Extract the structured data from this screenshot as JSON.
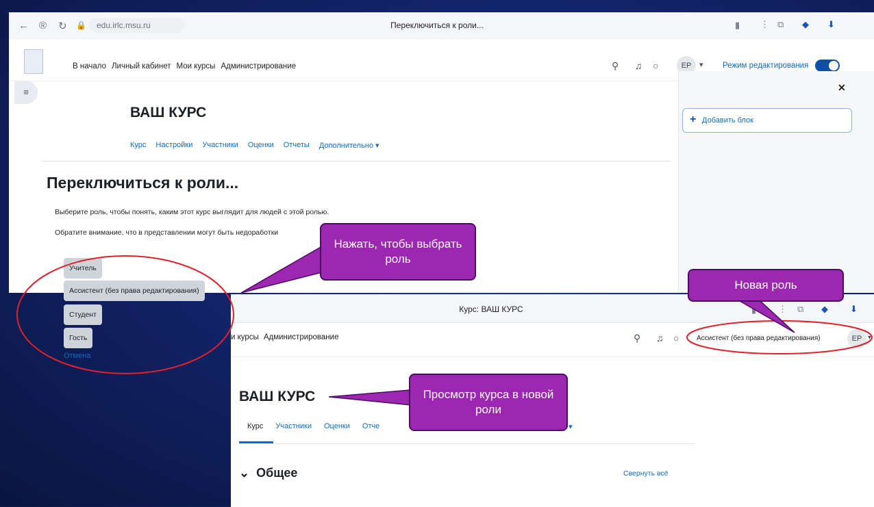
{
  "browser1": {
    "url": "edu.irlc.msu.ru",
    "tab_title": "Переключиться к роли..."
  },
  "nav": {
    "links": [
      "В начало",
      "Личный кабинет",
      "Мои курсы",
      "Администрирование"
    ],
    "avatar_initials": "ЕР",
    "edit_mode_label": "Режим редактирования",
    "edit_mode_on": true
  },
  "right_panel": {
    "add_block_label": "Добавить блок"
  },
  "course": {
    "title": "ВАШ КУРС",
    "tabs": [
      "Курс",
      "Настройки",
      "Участники",
      "Оценки",
      "Отчеты",
      "Дополнительно ▾"
    ]
  },
  "switch_role": {
    "heading": "Переключиться к роли...",
    "desc1": "Выберите роль, чтобы понять, каким этот курс выглядит для людей с этой ролью.",
    "desc2": "Обратите внимание, что в представлении могут быть недоработки",
    "roles": [
      "Учитель",
      "Ассистент (без права редактирования)",
      "Студент",
      "Гость"
    ],
    "cancel_label": "Отмена"
  },
  "browser2": {
    "tab_title": "Курс: ВАШ КУРС",
    "nav_links": [
      "и курсы",
      "Администрирование"
    ],
    "current_role": "Ассистент (без права редактирования)",
    "avatar_initials": "ЕР",
    "course_title": "ВАШ КУРС",
    "tabs": [
      "Курс",
      "Участники",
      "Оценки",
      "Отче"
    ],
    "tabs_tail": "о ▾",
    "section_title": "Общее",
    "section_chevron": "⌄",
    "collapse_all": "Свернуть всё"
  },
  "callouts": {
    "choose_role": "Нажать, чтобы выбрать роль",
    "new_role": "Новая роль",
    "view_course": "Просмотр курса в новой роли"
  },
  "colors": {
    "link_blue": "#0f6cbf",
    "callout_purple": "#9c27b0",
    "ellipse_red": "#e0202a",
    "toggle_blue": "#0f4fa8"
  }
}
